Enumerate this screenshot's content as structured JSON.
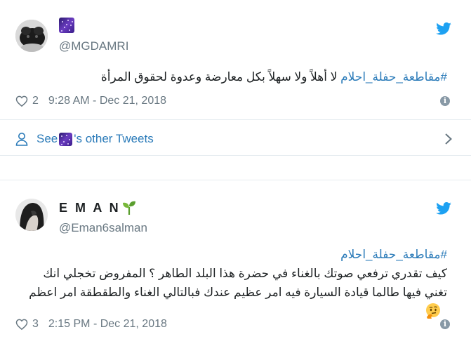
{
  "tweets": [
    {
      "display_name": "",
      "name_emoji": "night-sky-emoji",
      "handle": "@MGDAMRI",
      "hashtag": "#مقاطعة_حفلة_احلام",
      "text": " لا أهلاً ولا سهلاً بكل معارضة وعدوة لحقوق المرأة",
      "likes": "2",
      "timestamp": "9:28 AM - Dec 21, 2018",
      "see_more_prefix": "See ",
      "see_more_suffix": "'s other Tweets"
    },
    {
      "display_name": "E M A N",
      "name_emoji": "seedling-emoji",
      "handle": "@Eman6salman",
      "hashtag": "#مقاطعة_حفلة_احلام",
      "line1": "كيف تقدري ترفعي صوتك بالغناء في حضرة هذا البلد الطاهر ؟ المفروض تخجلي انك",
      "line2": "تغني فيها طالما قيادة السيارة فيه امر عظيم عندك فبالتالي الغناء والطقطقة امر اعظم",
      "trailing_emoji": "thinking-face-emoji",
      "likes": "3",
      "timestamp": "2:15 PM - Dec 21, 2018"
    }
  ],
  "colors": {
    "link": "#2b7bb9",
    "text": "#1c2022",
    "muted": "#697882",
    "twitter_blue": "#1da1f2",
    "border": "#e6ecf0"
  }
}
